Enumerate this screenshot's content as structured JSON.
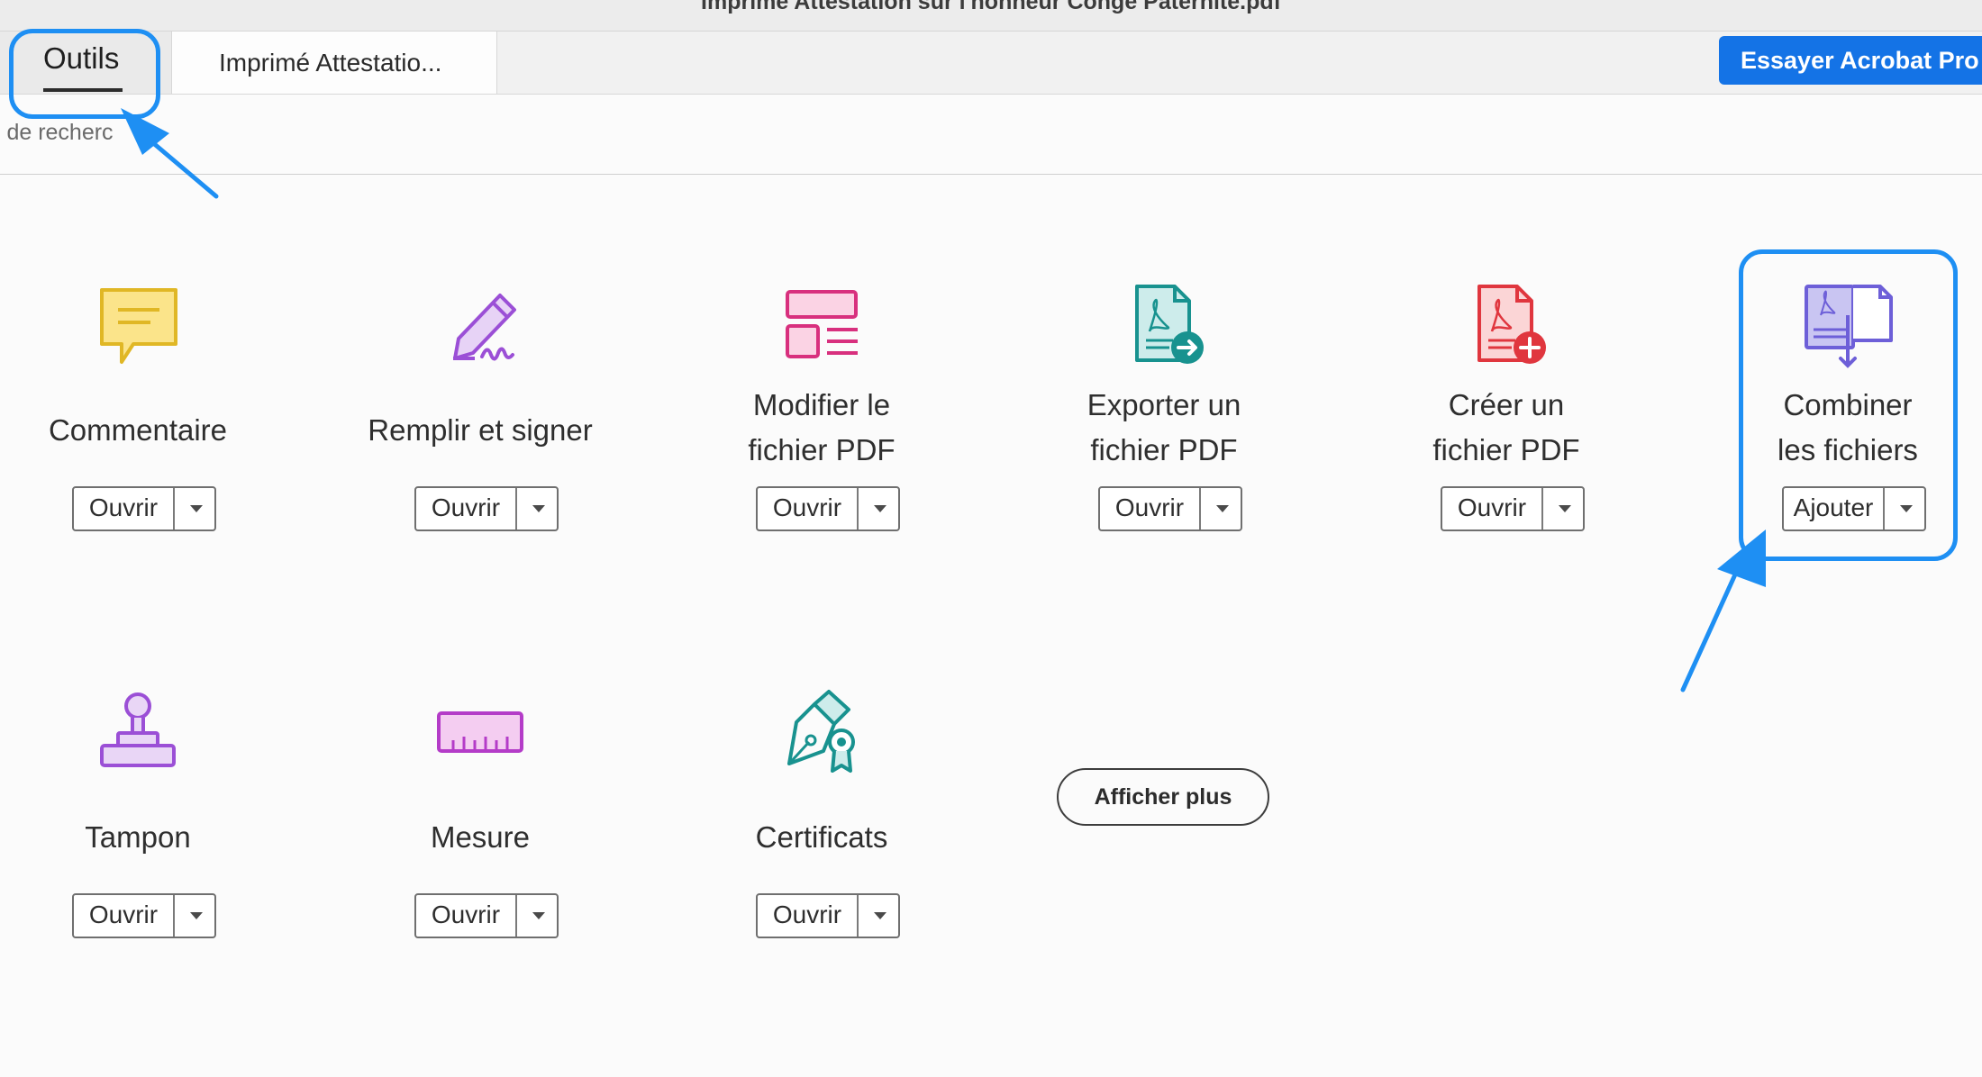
{
  "window": {
    "title": "Imprimé Attestation sur l'honneur Congé Paternité.pdf"
  },
  "tabs": {
    "tools_label": "Outils",
    "doc_label": "Imprimé Attestatio..."
  },
  "header": {
    "try_button": "Essayer Acrobat Pro"
  },
  "search": {
    "text": "s de recherc"
  },
  "tools": [
    {
      "name": "Commentaire",
      "icon": "comment-icon",
      "button": "Ouvrir",
      "color": "#e8c22b"
    },
    {
      "name": "Remplir et signer",
      "icon": "fill-sign-icon",
      "button": "Ouvrir",
      "color": "#9b4fd6"
    },
    {
      "name_line1": "Modifier le",
      "name_line2": "fichier PDF",
      "icon": "edit-pdf-icon",
      "button": "Ouvrir",
      "color": "#d8307e"
    },
    {
      "name_line1": "Exporter un",
      "name_line2": "fichier PDF",
      "icon": "export-pdf-icon",
      "button": "Ouvrir",
      "color": "#18928f"
    },
    {
      "name_line1": "Créer un",
      "name_line2": "fichier PDF",
      "icon": "create-pdf-icon",
      "button": "Ouvrir",
      "color": "#e0363e"
    },
    {
      "name_line1": "Combiner",
      "name_line2": "les fichiers",
      "icon": "combine-files-icon",
      "button": "Ajouter",
      "color": "#6d5fd8"
    },
    {
      "name": "Tampon",
      "icon": "stamp-icon",
      "button": "Ouvrir",
      "color": "#9b4fd6"
    },
    {
      "name": "Mesure",
      "icon": "measure-icon",
      "button": "Ouvrir",
      "color": "#b43cc8"
    },
    {
      "name": "Certificats",
      "icon": "certificates-icon",
      "button": "Ouvrir",
      "color": "#18928f"
    }
  ],
  "show_more": "Afficher plus",
  "colors": {
    "accent": "#1473e6",
    "annotation": "#1e8ff3"
  }
}
